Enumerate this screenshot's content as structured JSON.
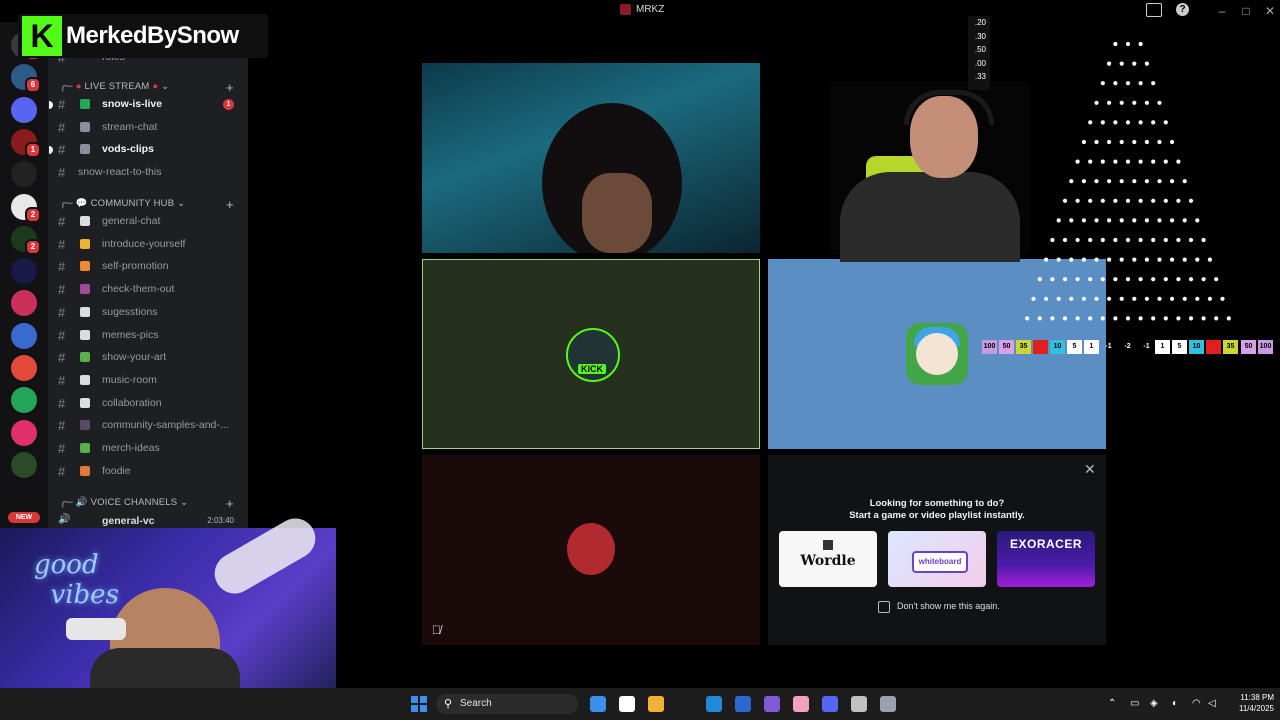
{
  "window": {
    "title": "MRKZ",
    "controls": [
      "–",
      "□",
      "✕"
    ]
  },
  "overlay": {
    "logo_letter": "K",
    "streamer_name": "MerkedBySnow"
  },
  "rail": {
    "new_label": "NEW",
    "servers": [
      {
        "color": "#3a3a3a",
        "badge": "2"
      },
      {
        "color": "#2d5a87",
        "badge": "6"
      },
      {
        "color": "#5865f2",
        "badge": ""
      },
      {
        "color": "#8b1a1a",
        "badge": "1"
      },
      {
        "color": "#222",
        "badge": ""
      },
      {
        "color": "#e8e8e8",
        "badge": "2"
      },
      {
        "color": "#1a3a1a",
        "badge": "2"
      },
      {
        "color": "#1a1a4a",
        "badge": ""
      },
      {
        "color": "#c9305a",
        "badge": ""
      },
      {
        "color": "#3a6ad0",
        "badge": ""
      },
      {
        "color": "#e24a3a",
        "badge": ""
      },
      {
        "color": "#23a55a",
        "badge": ""
      },
      {
        "color": "#e0306a",
        "badge": ""
      },
      {
        "color": "#2a4a2a",
        "badge": ""
      }
    ]
  },
  "channels": {
    "top_partial": "roles",
    "live_category": "LIVE STREAM",
    "live": [
      {
        "name": "snow-is-live",
        "unread": true,
        "mention": "1",
        "emoji_color": "#23a55a"
      },
      {
        "name": "stream-chat",
        "unread": false,
        "mention": "",
        "emoji_color": "#8a8fa0"
      },
      {
        "name": "vods-clips",
        "unread": true,
        "mention": "",
        "emoji_color": "#8a8fa0"
      },
      {
        "name": "snow-react-to-this",
        "unread": false,
        "mention": "",
        "emoji_color": ""
      }
    ],
    "community_category": "COMMUNITY HUB",
    "community": [
      {
        "name": "general-chat",
        "emoji_color": "#dbdee1"
      },
      {
        "name": "introduce-yourself",
        "emoji_color": "#f0b232"
      },
      {
        "name": "self-promotion",
        "emoji_color": "#f08a32"
      },
      {
        "name": "check-them-out",
        "emoji_color": "#a04a9a"
      },
      {
        "name": "sugesstions",
        "emoji_color": "#dbdee1"
      },
      {
        "name": "memes-pics",
        "emoji_color": "#dbdee1"
      },
      {
        "name": "show-your-art",
        "emoji_color": "#5ab04a"
      },
      {
        "name": "music-room",
        "emoji_color": "#dbdee1"
      },
      {
        "name": "collaboration",
        "emoji_color": "#dbdee1"
      },
      {
        "name": "community-samples-and-...",
        "emoji_color": "#5a4a6a"
      },
      {
        "name": "merch-ideas",
        "emoji_color": "#5ab04a"
      },
      {
        "name": "foodie",
        "emoji_color": "#e07a3a"
      }
    ],
    "voice_category": "VOICE CHANNELS",
    "voice": {
      "name": "general-vc",
      "timer": "2:03:40"
    }
  },
  "activity": {
    "line1": "Looking for something to do?",
    "line2": "Start a game or video playlist instantly.",
    "cards": [
      "Wordle",
      "whiteboard",
      "EXORACER"
    ],
    "checkbox_label": "Don't show me this again."
  },
  "tiles": {
    "kick_label": "KICK"
  },
  "plinko": {
    "scores": [
      ".20",
      ".30",
      ".50",
      ".00",
      ".33"
    ],
    "slots": [
      {
        "v": "100",
        "c": "#c89be0"
      },
      {
        "v": "50",
        "c": "#d8a0e8"
      },
      {
        "v": "35",
        "c": "#c8d830"
      },
      {
        "v": "",
        "c": "#e02020"
      },
      {
        "v": "10",
        "c": "#30c0e0"
      },
      {
        "v": "5",
        "c": "#ffffff"
      },
      {
        "v": "1",
        "c": "#ffffff"
      },
      {
        "v": "-1",
        "c": ""
      },
      {
        "v": "-2",
        "c": ""
      },
      {
        "v": "-1",
        "c": ""
      },
      {
        "v": "1",
        "c": "#ffffff"
      },
      {
        "v": "5",
        "c": "#ffffff"
      },
      {
        "v": "10",
        "c": "#30c0e0"
      },
      {
        "v": "",
        "c": "#e02020"
      },
      {
        "v": "35",
        "c": "#c8d830"
      },
      {
        "v": "50",
        "c": "#d8a0e8"
      },
      {
        "v": "100",
        "c": "#c89be0"
      }
    ]
  },
  "taskbar": {
    "search": "Search",
    "time": "11:38 PM",
    "date": "11/4/2025",
    "apps": [
      "#3b8eea",
      "#ffffff",
      "#7a6ad0",
      "#f0b232",
      "#1f8ad8",
      "#2a6ad0",
      "#7f5ad8",
      "#f0a0c0",
      "#5865f2",
      "#c0c0c0",
      "#9aa0b0"
    ]
  }
}
